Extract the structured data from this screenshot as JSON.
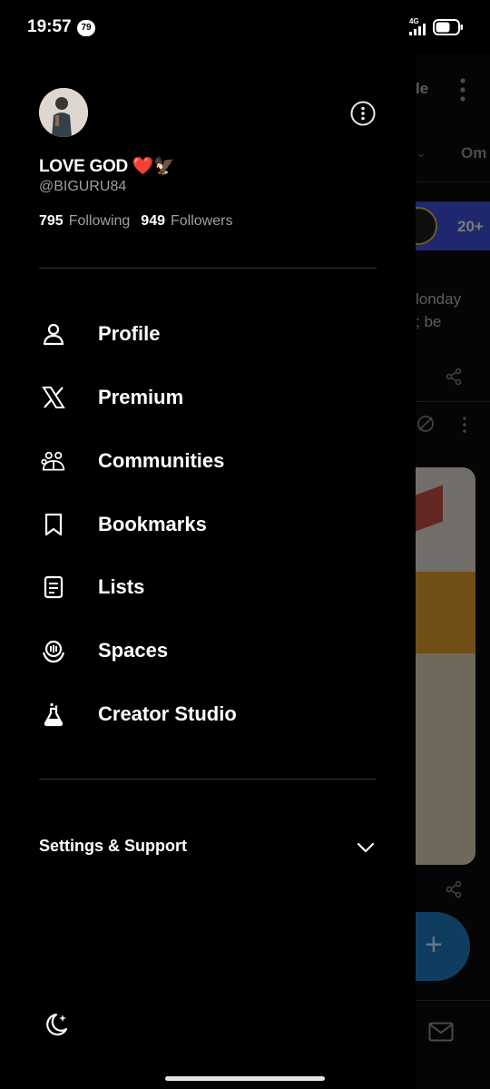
{
  "status_bar": {
    "time": "19:57",
    "notification_count": "79",
    "network": "4G"
  },
  "profile": {
    "display_name": "LOVE GOD ❤️🦅",
    "handle": "@BIGURU84",
    "following_count": "795",
    "following_label": "Following",
    "followers_count": "949",
    "followers_label": "Followers"
  },
  "nav": {
    "items": [
      {
        "label": "Profile",
        "icon": "person-icon"
      },
      {
        "label": "Premium",
        "icon": "x-logo-icon"
      },
      {
        "label": "Communities",
        "icon": "communities-icon"
      },
      {
        "label": "Bookmarks",
        "icon": "bookmark-icon"
      },
      {
        "label": "Lists",
        "icon": "list-icon"
      },
      {
        "label": "Spaces",
        "icon": "spaces-icon"
      },
      {
        "label": "Creator Studio",
        "icon": "flask-icon"
      }
    ]
  },
  "settings": {
    "label": "Settings & Support"
  },
  "background_feed": {
    "topbar_text": "le",
    "tab_text": "Om",
    "banner_text": "20+",
    "post_line_1": "londay",
    "post_line_2": "; be"
  },
  "colors": {
    "background": "#000000",
    "text_primary": "#ffffff",
    "text_secondary": "#9aa0a6",
    "divider": "#2f3336",
    "fab": "#1d6fb0"
  }
}
